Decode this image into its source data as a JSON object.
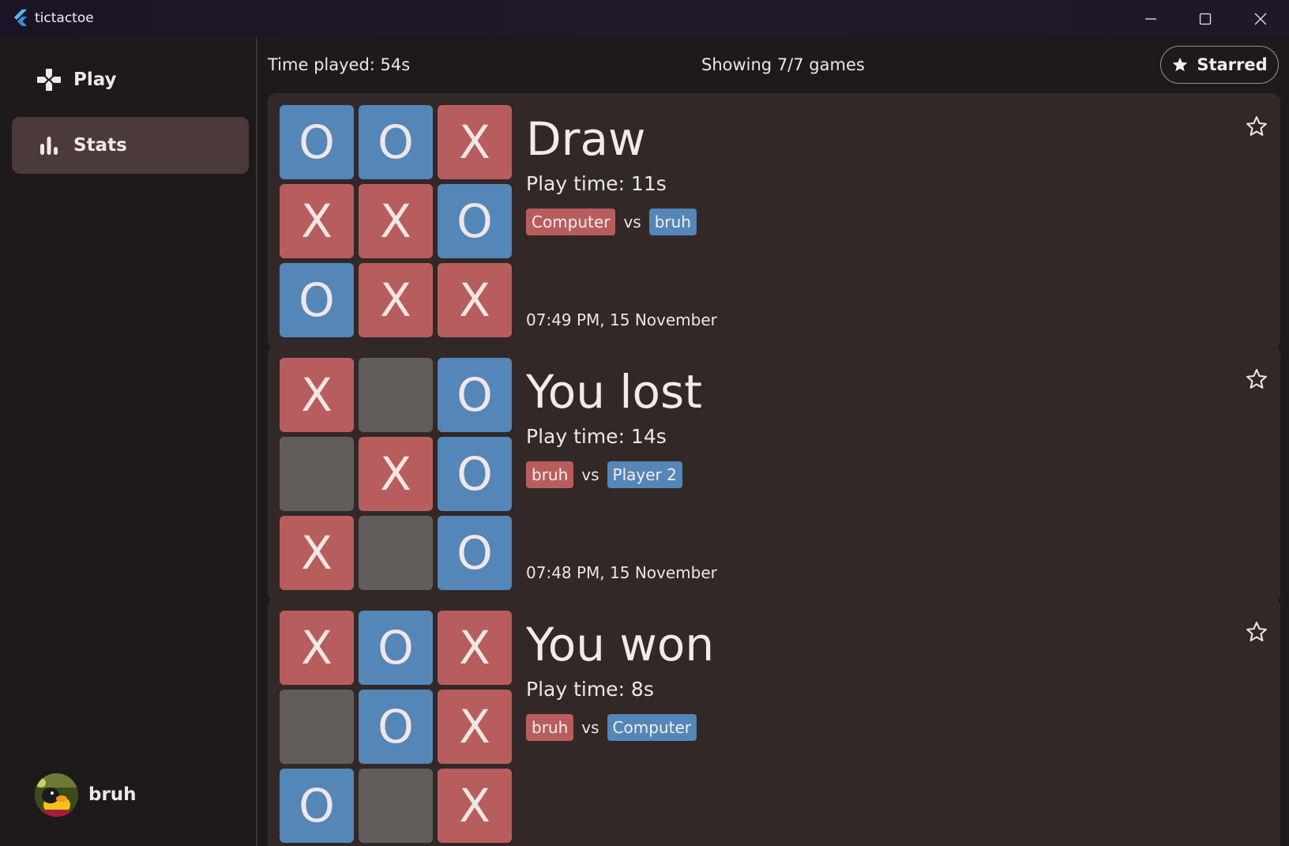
{
  "window": {
    "title": "tictactoe",
    "controls": [
      "minimize-icon",
      "maximize-icon",
      "close-icon"
    ]
  },
  "sidebar": {
    "items": [
      {
        "label": "Play",
        "icon": "gamepad-icon",
        "active": false
      },
      {
        "label": "Stats",
        "icon": "bar-chart-icon",
        "active": true
      }
    ],
    "user": {
      "name": "bruh",
      "avatar": "duck-avatar"
    }
  },
  "topbar": {
    "time_played": "Time played: 54s",
    "showing": "Showing 7/7 games",
    "starred_label": "Starred",
    "starred_icon": "star-filled-icon"
  },
  "colors": {
    "x_tile": "#b85d5d",
    "o_tile": "#5486b8",
    "empty_tile": "#625d5b",
    "card": "#322828",
    "active_nav": "#4c393b"
  },
  "games": [
    {
      "result": "Draw",
      "play_time": "Play time: 11s",
      "player1": "Computer",
      "vs": "vs",
      "player2": "bruh",
      "date": "07:49 PM, 15 November",
      "board": [
        "O",
        "O",
        "X",
        "X",
        "X",
        "O",
        "O",
        "X",
        "X"
      ],
      "starred": false
    },
    {
      "result": "You lost",
      "play_time": "Play time: 14s",
      "player1": "bruh",
      "vs": "vs",
      "player2": "Player 2",
      "date": "07:48 PM, 15 November",
      "board": [
        "X",
        "",
        "O",
        "",
        "X",
        "O",
        "X",
        "",
        "O"
      ],
      "starred": false
    },
    {
      "result": "You won",
      "play_time": "Play time: 8s",
      "player1": "bruh",
      "vs": "vs",
      "player2": "Computer",
      "date": "",
      "board": [
        "X",
        "O",
        "X",
        "",
        "O",
        "X",
        "O",
        "",
        "X"
      ],
      "starred": false
    }
  ]
}
